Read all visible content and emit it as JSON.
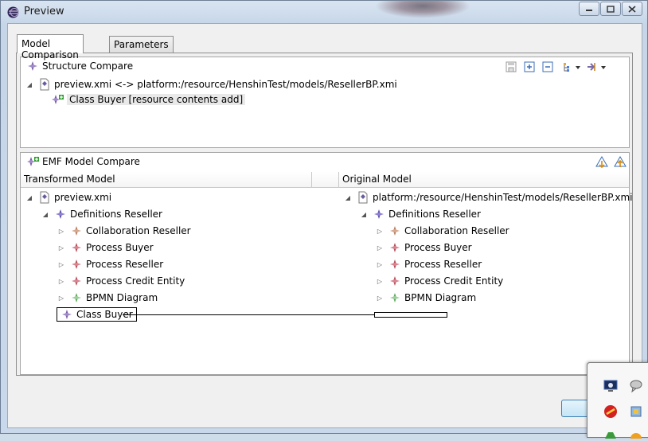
{
  "window": {
    "title": "Preview"
  },
  "tabs": [
    {
      "label": "Model Comparison",
      "active": true
    },
    {
      "label": "Parameters",
      "active": false
    }
  ],
  "structure_compare": {
    "title": "Structure Compare",
    "root": "preview.xmi <-> platform:/resource/HenshinTest/models/ResellerBP.xmi",
    "child": "Class Buyer [resource contents add]"
  },
  "emf_compare": {
    "title": "EMF Model Compare",
    "left_header": "Transformed Model",
    "right_header": "Original Model",
    "left_root": "preview.xmi",
    "right_root": "platform:/resource/HenshinTest/models/ResellerBP.xmi",
    "definitions": "Definitions Reseller",
    "children": [
      {
        "label": "Collaboration Reseller",
        "icon": "collaboration-icon"
      },
      {
        "label": "Process Buyer",
        "icon": "process-icon"
      },
      {
        "label": "Process Reseller",
        "icon": "process-icon"
      },
      {
        "label": "Process Credit Entity",
        "icon": "process-icon"
      },
      {
        "label": "BPMN Diagram",
        "icon": "diagram-icon"
      }
    ],
    "added": "Class Buyer"
  }
}
